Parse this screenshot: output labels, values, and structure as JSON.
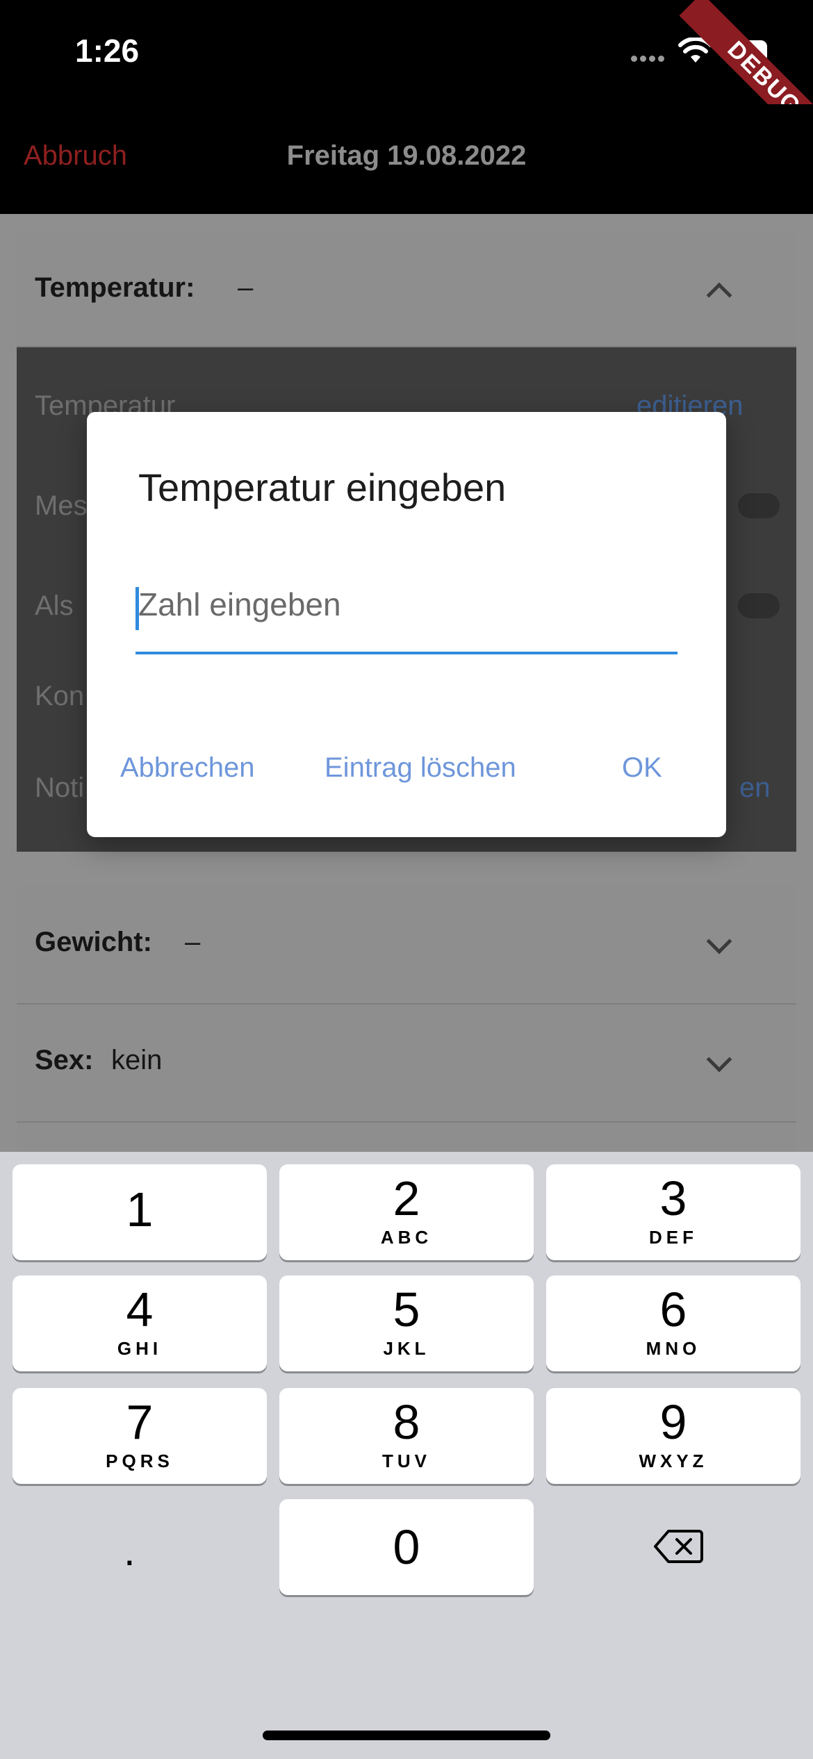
{
  "status_bar": {
    "time": "1:26",
    "debug_banner": "DEBUG"
  },
  "app_bar": {
    "cancel": "Abbruch",
    "title": "Freitag 19.08.2022"
  },
  "background": {
    "temperature_section": {
      "label": "Temperatur:",
      "value": "–"
    },
    "temperature_rows": [
      {
        "label": "Temperatur",
        "action": "editieren"
      },
      {
        "label": "Mes"
      },
      {
        "label": "Als"
      },
      {
        "label": "Kon"
      },
      {
        "label": "Noti",
        "action": "en"
      }
    ],
    "weight_section": {
      "label": "Gewicht:",
      "value": "–"
    },
    "sex_section": {
      "label": "Sex:",
      "value": "kein"
    }
  },
  "dialog": {
    "title": "Temperatur eingeben",
    "input_placeholder": "Zahl eingeben",
    "input_value": "",
    "buttons": {
      "cancel": "Abbrechen",
      "delete": "Eintrag löschen",
      "ok": "OK"
    },
    "accent_color": "#2f8bde"
  },
  "keyboard": {
    "keys": [
      {
        "num": "1",
        "letters": ""
      },
      {
        "num": "2",
        "letters": "ABC"
      },
      {
        "num": "3",
        "letters": "DEF"
      },
      {
        "num": "4",
        "letters": "GHI"
      },
      {
        "num": "5",
        "letters": "JKL"
      },
      {
        "num": "6",
        "letters": "MNO"
      },
      {
        "num": "7",
        "letters": "PQRS"
      },
      {
        "num": "8",
        "letters": "TUV"
      },
      {
        "num": "9",
        "letters": "WXYZ"
      },
      {
        "num": "0",
        "letters": ""
      }
    ],
    "decimal_key": ".",
    "delete_icon": "backspace-icon"
  }
}
